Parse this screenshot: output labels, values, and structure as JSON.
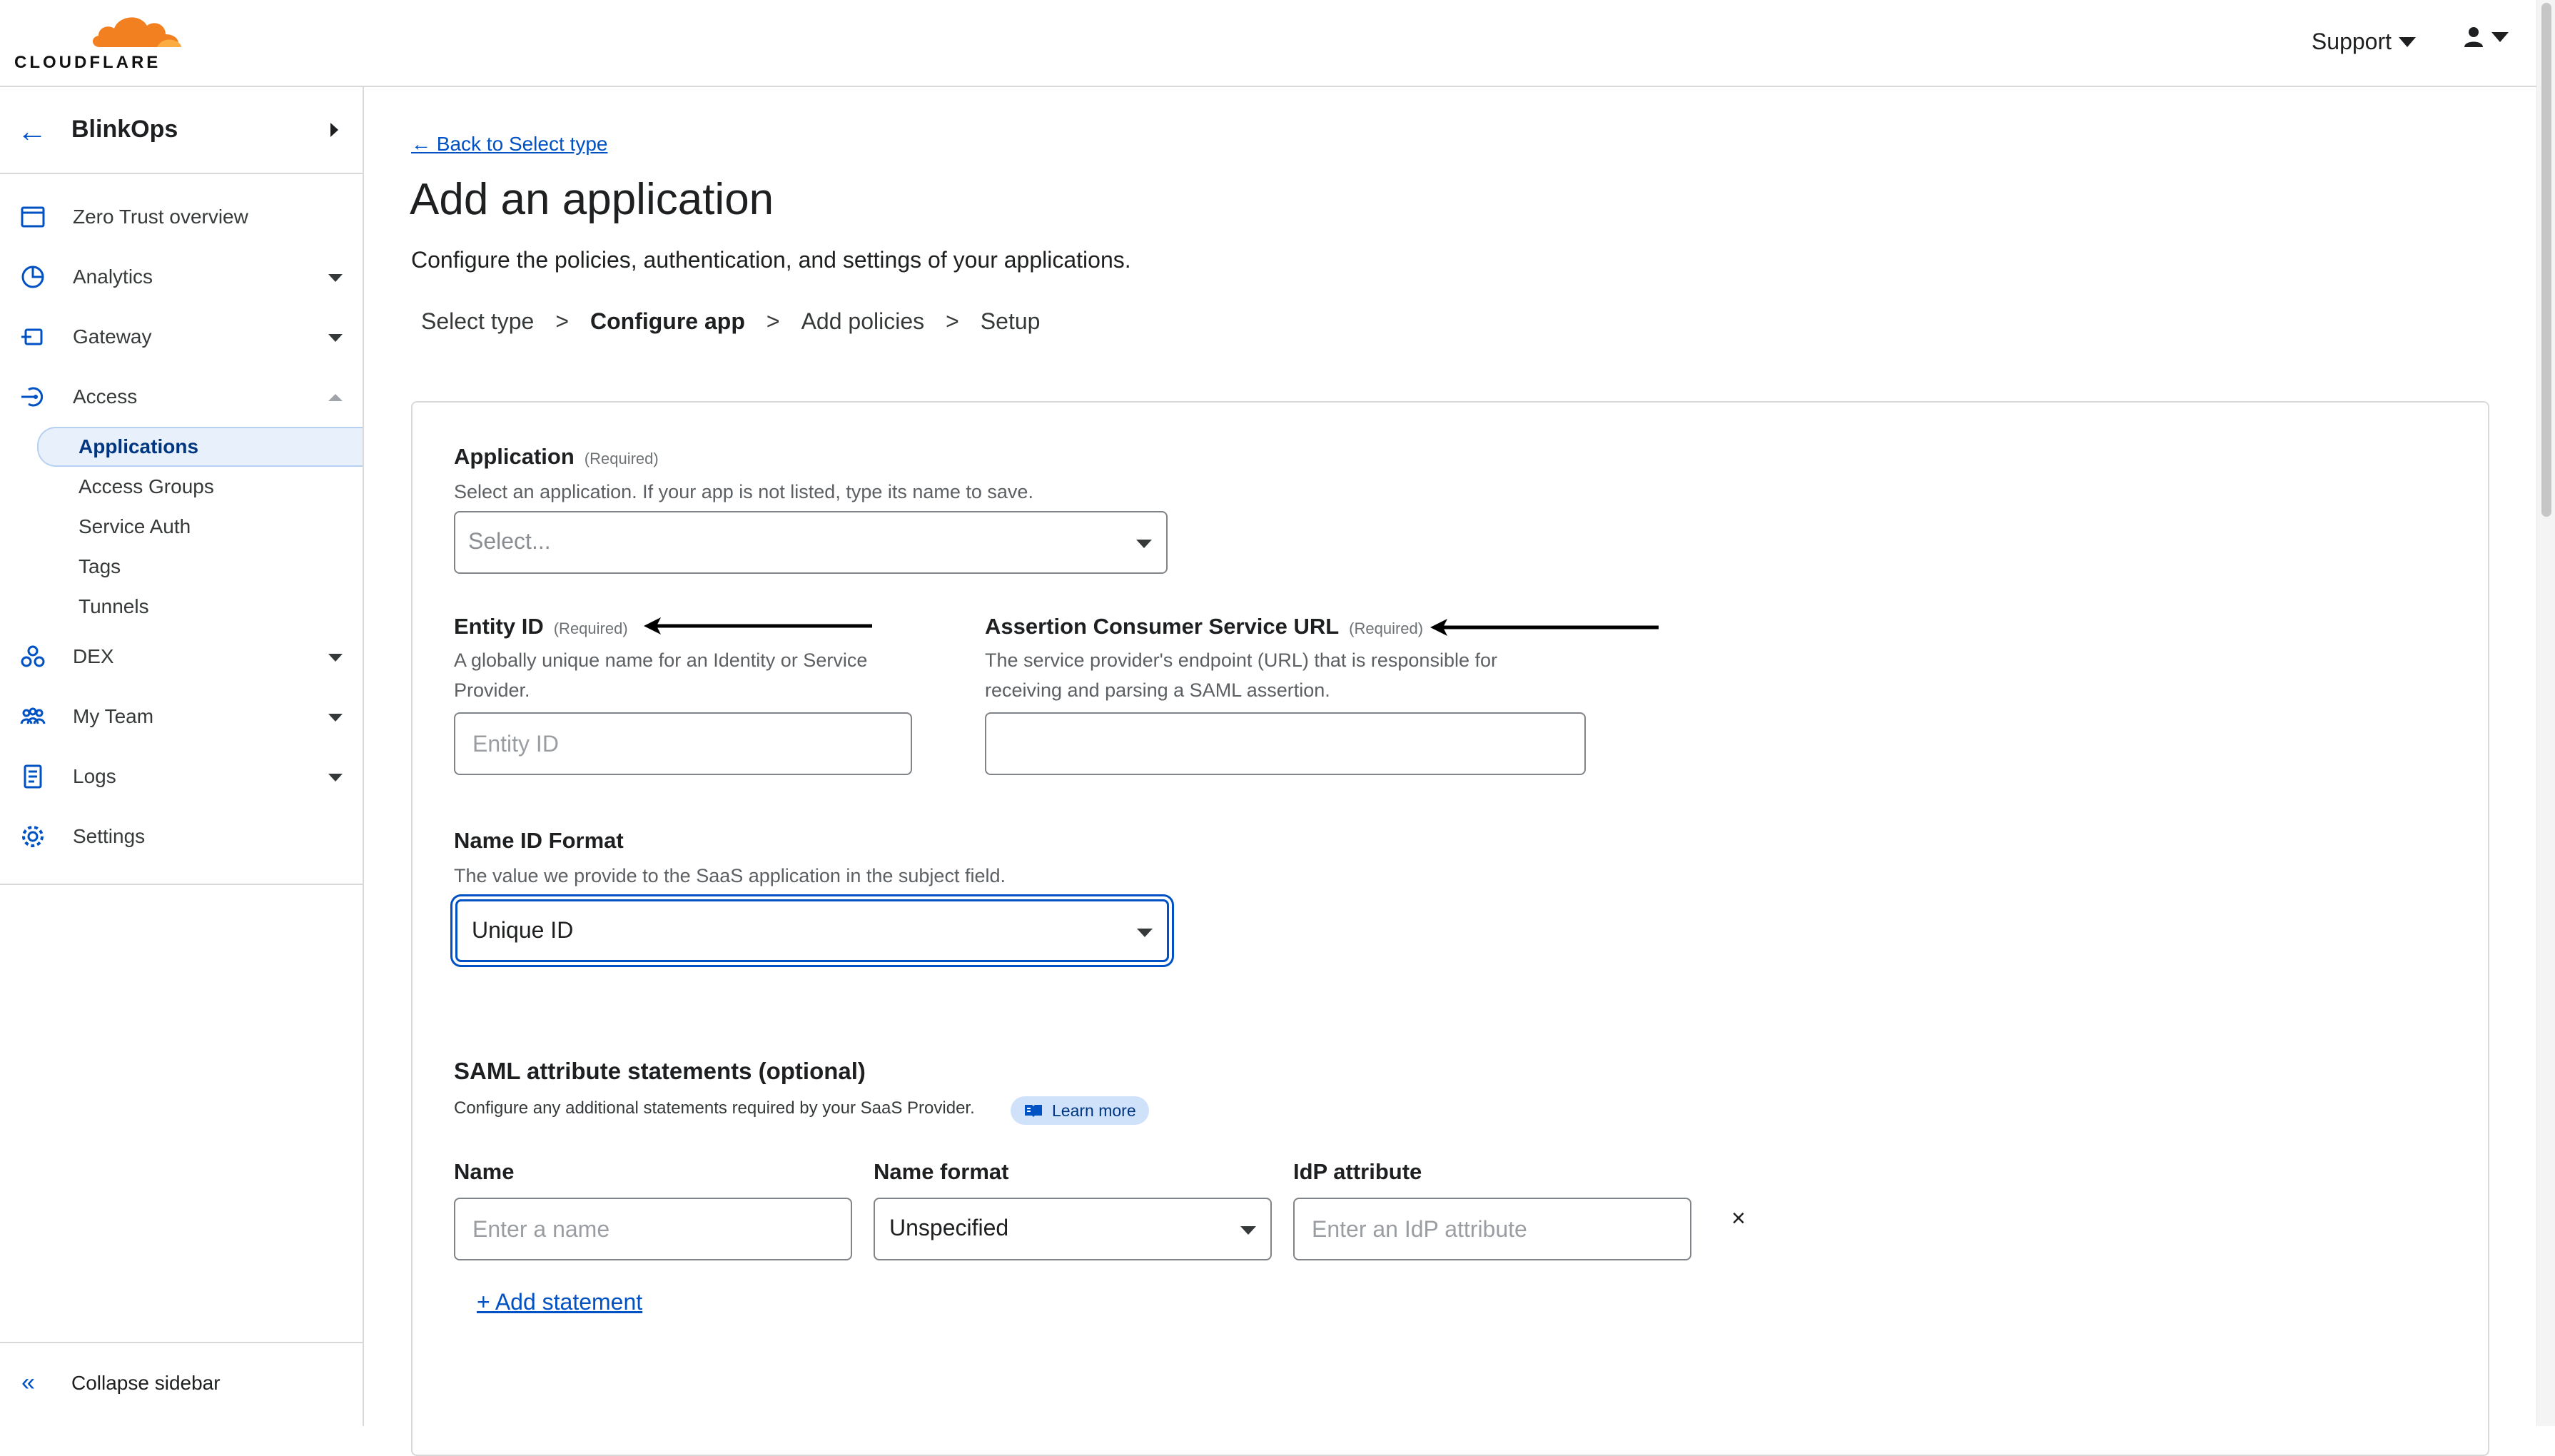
{
  "brand": {
    "logo_text": "CLOUDFLARE",
    "accent": "#0051c3",
    "logo_orange": "#f38020"
  },
  "header": {
    "support_label": "Support"
  },
  "sidebar": {
    "account_name": "BlinkOps",
    "items": [
      {
        "label": "Zero Trust overview",
        "icon": "dashboard-icon"
      },
      {
        "label": "Analytics",
        "icon": "pie-chart-icon"
      },
      {
        "label": "Gateway",
        "icon": "gateway-icon"
      },
      {
        "label": "Access",
        "icon": "access-icon"
      },
      {
        "label": "DEX",
        "icon": "dex-icon"
      },
      {
        "label": "My Team",
        "icon": "team-icon"
      },
      {
        "label": "Logs",
        "icon": "logs-icon"
      },
      {
        "label": "Settings",
        "icon": "gear-icon"
      }
    ],
    "access_sub": [
      "Applications",
      "Access Groups",
      "Service Auth",
      "Tags",
      "Tunnels"
    ],
    "collapse_label": "Collapse sidebar"
  },
  "main": {
    "back_link": "← Back to Select type",
    "title": "Add an application",
    "description": "Configure the policies, authentication, and settings of your applications.",
    "steps": [
      "Select type",
      "Configure app",
      "Add policies",
      "Setup"
    ],
    "step_separator": ">",
    "current_step": "Configure app"
  },
  "form": {
    "application": {
      "label": "Application",
      "required": "(Required)",
      "help": "Select an application. If your app is not listed, type its name to save.",
      "placeholder": "Select..."
    },
    "entity_id": {
      "label": "Entity ID",
      "required": "(Required)",
      "help": "A globally unique name for an Identity or Service Provider.",
      "placeholder": "Entity ID",
      "value": ""
    },
    "acs_url": {
      "label": "Assertion Consumer Service URL",
      "required": "(Required)",
      "help": "The service provider's endpoint (URL) that is responsible for receiving and parsing a SAML assertion.",
      "value": ""
    },
    "name_id_format": {
      "label": "Name ID Format",
      "help": "The value we provide to the SaaS application in the subject field.",
      "value": "Unique ID"
    },
    "saml": {
      "title": "SAML attribute statements (optional)",
      "help": "Configure any additional statements required by your SaaS Provider.",
      "learn_more": "Learn more",
      "col_name": "Name",
      "col_format": "Name format",
      "col_idp": "IdP attribute",
      "name_placeholder": "Enter a name",
      "format_value": "Unspecified",
      "idp_placeholder": "Enter an IdP attribute",
      "remove": "×",
      "add_statement": "+ Add statement"
    }
  }
}
